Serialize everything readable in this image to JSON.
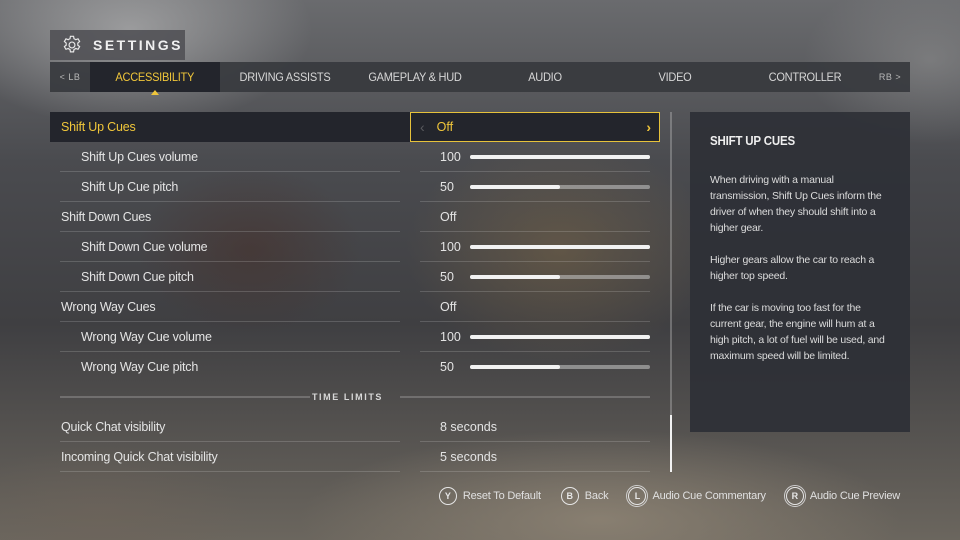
{
  "header": {
    "title": "SETTINGS",
    "icon": "gear-icon"
  },
  "tabs": {
    "left_bumper": "< LB",
    "right_bumper": "RB >",
    "items": [
      {
        "label": "ACCESSIBILITY",
        "active": true
      },
      {
        "label": "DRIVING ASSISTS",
        "active": false
      },
      {
        "label": "GAMEPLAY & HUD",
        "active": false
      },
      {
        "label": "AUDIO",
        "active": false
      },
      {
        "label": "VIDEO",
        "active": false
      },
      {
        "label": "CONTROLLER",
        "active": false
      }
    ]
  },
  "settings": {
    "selected": {
      "label": "Shift Up Cues",
      "value": "Off",
      "arrow_left": "‹",
      "arrow_right": "›"
    },
    "rows": [
      {
        "label": "Shift Up Cues volume",
        "value": "100",
        "slider_fraction": 1.0
      },
      {
        "label": "Shift Up Cue pitch",
        "value": "50",
        "slider_fraction": 0.5
      },
      {
        "label": "Shift Down Cues",
        "value": "Off"
      },
      {
        "label": "Shift Down Cue volume",
        "value": "100",
        "slider_fraction": 1.0
      },
      {
        "label": "Shift Down Cue pitch",
        "value": "50",
        "slider_fraction": 0.5
      },
      {
        "label": "Wrong Way Cues",
        "value": "Off"
      },
      {
        "label": "Wrong Way Cue volume",
        "value": "100",
        "slider_fraction": 1.0
      },
      {
        "label": "Wrong Way Cue pitch",
        "value": "50",
        "slider_fraction": 0.5
      }
    ],
    "section_time_limits": "TIME LIMITS",
    "time_rows": [
      {
        "label": "Quick Chat visibility",
        "value": "8 seconds"
      },
      {
        "label": "Incoming Quick Chat visibility",
        "value": "5 seconds"
      }
    ],
    "scroll_position": "bottom"
  },
  "info_panel": {
    "title": "SHIFT UP CUES",
    "paragraphs": [
      "When driving with a manual transmission, Shift Up Cues inform the driver of when they should shift into a higher gear.",
      "Higher gears allow the car to reach a higher top speed.",
      "If the car is moving too fast for the current gear, the engine will hum at a high pitch, a lot of fuel will be used, and maximum speed will be limited."
    ]
  },
  "footer": {
    "hints": [
      {
        "button": "Y",
        "label": "Reset To Default"
      },
      {
        "button": "B",
        "label": "Back"
      },
      {
        "button": "L",
        "label": "Audio Cue Commentary"
      },
      {
        "button": "R",
        "label": "Audio Cue Preview"
      }
    ]
  },
  "colors": {
    "accent": "#f0c63a",
    "selected_bg": "#23252c"
  }
}
